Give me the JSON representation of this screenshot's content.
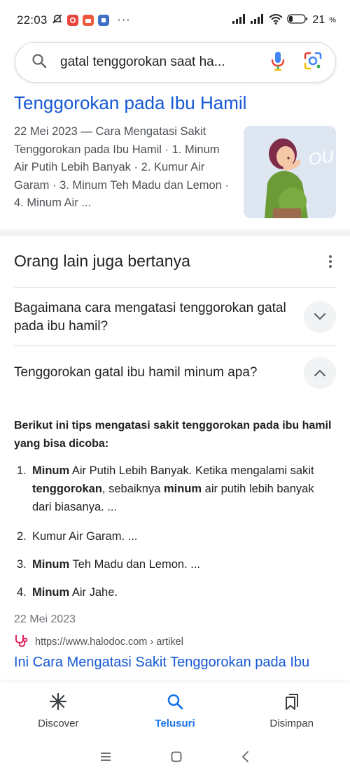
{
  "status_bar": {
    "time": "22:03",
    "dots": "···",
    "battery": "21"
  },
  "search": {
    "query": "gatal tenggorokan saat ha..."
  },
  "top_result": {
    "title": "Tenggorokan pada Ibu Hamil",
    "snippet": "22 Mei 2023 — Cara Mengatasi Sakit Tenggorokan pada Ibu Hamil · 1. Minum Air Putih Lebih Banyak · 2. Kumur Air Garam · 3. Minum Teh Madu dan Lemon · 4. Minum Air ...",
    "thumb_icon": "pregnant-woman-coughing-illustration"
  },
  "paa": {
    "heading": "Orang lain juga bertanya",
    "questions": [
      {
        "text": "Bagaimana cara mengatasi tenggorokan gatal pada ibu hamil?",
        "state": "collapsed"
      },
      {
        "text": "Tenggorokan gatal ibu hamil minum apa?",
        "state": "expanded"
      }
    ],
    "answer": {
      "intro": "Berikut ini tips mengatasi sakit tenggorokan pada ibu hamil yang bisa dicoba:",
      "items": [
        {
          "num": "1.",
          "bold1": "Minum",
          "t1": " Air Putih Lebih Banyak. Ketika mengalami sakit ",
          "bold2": "tenggorokan",
          "t2": ", sebaiknya ",
          "bold3": "minum",
          "t3": " air putih lebih banyak dari biasanya. ..."
        },
        {
          "num": "2.",
          "bold1": "",
          "t1": "Kumur Air Garam. ...",
          "bold2": "",
          "t2": "",
          "bold3": "",
          "t3": ""
        },
        {
          "num": "3.",
          "bold1": "Minum",
          "t1": " Teh Madu dan Lemon. ...",
          "bold2": "",
          "t2": "",
          "bold3": "",
          "t3": ""
        },
        {
          "num": "4.",
          "bold1": "Minum",
          "t1": " Air Jahe.",
          "bold2": "",
          "t2": "",
          "bold3": "",
          "t3": ""
        }
      ],
      "date": "22 Mei 2023",
      "source_url": "https://www.halodoc.com › artikel",
      "link_title": "Ini Cara Mengatasi Sakit Tenggorokan pada Ibu"
    }
  },
  "bottom_nav": {
    "items": [
      {
        "label": "Discover",
        "icon": "asterisk-icon",
        "active": false
      },
      {
        "label": "Telusuri",
        "icon": "search-icon",
        "active": true
      },
      {
        "label": "Disimpan",
        "icon": "bookmarks-icon",
        "active": false
      }
    ]
  },
  "colors": {
    "link": "#1558d6",
    "active_nav": "#1a73e8",
    "text": "#202124",
    "muted": "#4d5156"
  }
}
